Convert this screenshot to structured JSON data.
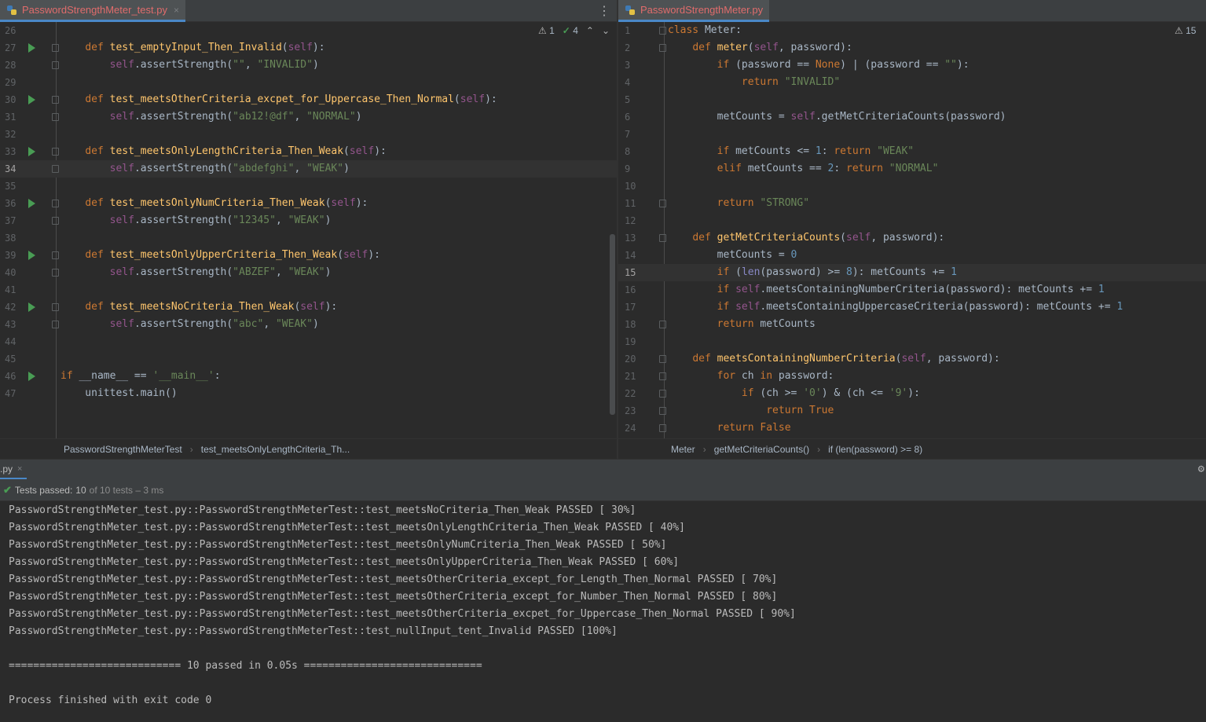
{
  "left_tab": {
    "filename": "PasswordStrengthMeter_test.py",
    "close": "×"
  },
  "right_tab": {
    "filename": "PasswordStrengthMeter.py"
  },
  "left_indicators": {
    "warnings": "1",
    "ok": "4"
  },
  "right_indicators": {
    "warnings": "15"
  },
  "left_lines": [
    {
      "n": "26",
      "code": ""
    },
    {
      "n": "27",
      "code": "    def test_emptyInput_Then_Invalid(self):"
    },
    {
      "n": "28",
      "code": "        self.assertStrength(\"\", \"INVALID\")"
    },
    {
      "n": "29",
      "code": ""
    },
    {
      "n": "30",
      "code": "    def test_meetsOtherCriteria_excpet_for_Uppercase_Then_Normal(self):"
    },
    {
      "n": "31",
      "code": "        self.assertStrength(\"ab12!@df\", \"NORMAL\")"
    },
    {
      "n": "32",
      "code": ""
    },
    {
      "n": "33",
      "code": "    def test_meetsOnlyLengthCriteria_Then_Weak(self):"
    },
    {
      "n": "34",
      "code": "        self.assertStrength(\"abdefghi\", \"WEAK\")"
    },
    {
      "n": "35",
      "code": ""
    },
    {
      "n": "36",
      "code": "    def test_meetsOnlyNumCriteria_Then_Weak(self):"
    },
    {
      "n": "37",
      "code": "        self.assertStrength(\"12345\", \"WEAK\")"
    },
    {
      "n": "38",
      "code": ""
    },
    {
      "n": "39",
      "code": "    def test_meetsOnlyUpperCriteria_Then_Weak(self):"
    },
    {
      "n": "40",
      "code": "        self.assertStrength(\"ABZEF\", \"WEAK\")"
    },
    {
      "n": "41",
      "code": ""
    },
    {
      "n": "42",
      "code": "    def test_meetsNoCriteria_Then_Weak(self):"
    },
    {
      "n": "43",
      "code": "        self.assertStrength(\"abc\", \"WEAK\")"
    },
    {
      "n": "44",
      "code": ""
    },
    {
      "n": "45",
      "code": ""
    },
    {
      "n": "46",
      "code": "if __name__ == '__main__':"
    },
    {
      "n": "47",
      "code": "    unittest.main()"
    }
  ],
  "right_lines": [
    {
      "n": "1",
      "code": "class Meter:"
    },
    {
      "n": "2",
      "code": "    def meter(self, password):"
    },
    {
      "n": "3",
      "code": "        if (password == None) | (password == \"\"):"
    },
    {
      "n": "4",
      "code": "            return \"INVALID\""
    },
    {
      "n": "5",
      "code": ""
    },
    {
      "n": "6",
      "code": "        metCounts = self.getMetCriteriaCounts(password)"
    },
    {
      "n": "7",
      "code": ""
    },
    {
      "n": "8",
      "code": "        if metCounts <= 1: return \"WEAK\""
    },
    {
      "n": "9",
      "code": "        elif metCounts == 2: return \"NORMAL\""
    },
    {
      "n": "10",
      "code": ""
    },
    {
      "n": "11",
      "code": "        return \"STRONG\""
    },
    {
      "n": "12",
      "code": ""
    },
    {
      "n": "13",
      "code": "    def getMetCriteriaCounts(self, password):"
    },
    {
      "n": "14",
      "code": "        metCounts = 0"
    },
    {
      "n": "15",
      "code": "        if (len(password) >= 8): metCounts += 1"
    },
    {
      "n": "16",
      "code": "        if self.meetsContainingNumberCriteria(password): metCounts += 1"
    },
    {
      "n": "17",
      "code": "        if self.meetsContainingUppercaseCriteria(password): metCounts += 1"
    },
    {
      "n": "18",
      "code": "        return metCounts"
    },
    {
      "n": "19",
      "code": ""
    },
    {
      "n": "20",
      "code": "    def meetsContainingNumberCriteria(self, password):"
    },
    {
      "n": "21",
      "code": "        for ch in password:"
    },
    {
      "n": "22",
      "code": "            if (ch >= '0') & (ch <= '9'):"
    },
    {
      "n": "23",
      "code": "                return True"
    },
    {
      "n": "24",
      "code": "        return False"
    }
  ],
  "left_breadcrumb": [
    "PasswordStrengthMeterTest",
    "test_meetsOnlyLengthCriteria_Th..."
  ],
  "right_breadcrumb": [
    "Meter",
    "getMetCriteriaCounts()",
    "if (len(password) >= 8)"
  ],
  "run_tab": {
    "label": ".py",
    "close": "×"
  },
  "status": {
    "label": "Tests passed:",
    "passed": "10",
    "of": "of 10 tests – 3 ms"
  },
  "console": [
    "PasswordStrengthMeter_test.py::PasswordStrengthMeterTest::test_meetsNoCriteria_Then_Weak PASSED [ 30%]",
    "PasswordStrengthMeter_test.py::PasswordStrengthMeterTest::test_meetsOnlyLengthCriteria_Then_Weak PASSED [ 40%]",
    "PasswordStrengthMeter_test.py::PasswordStrengthMeterTest::test_meetsOnlyNumCriteria_Then_Weak PASSED [ 50%]",
    "PasswordStrengthMeter_test.py::PasswordStrengthMeterTest::test_meetsOnlyUpperCriteria_Then_Weak PASSED [ 60%]",
    "PasswordStrengthMeter_test.py::PasswordStrengthMeterTest::test_meetsOtherCriteria_except_for_Length_Then_Normal PASSED [ 70%]",
    "PasswordStrengthMeter_test.py::PasswordStrengthMeterTest::test_meetsOtherCriteria_except_for_Number_Then_Normal PASSED [ 80%]",
    "PasswordStrengthMeter_test.py::PasswordStrengthMeterTest::test_meetsOtherCriteria_excpet_for_Uppercase_Then_Normal PASSED [ 90%]",
    "PasswordStrengthMeter_test.py::PasswordStrengthMeterTest::test_nullInput_tent_Invalid PASSED [100%]",
    "",
    "============================ 10 passed in 0.05s =============================",
    "",
    "Process finished with exit code 0"
  ]
}
